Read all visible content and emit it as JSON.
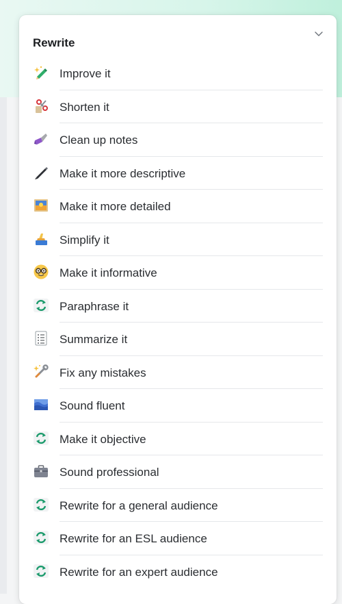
{
  "panel": {
    "title": "Rewrite"
  },
  "items": [
    {
      "label": "Improve it",
      "icon": "pencil-sparkle-icon"
    },
    {
      "label": "Shorten it",
      "icon": "scissors-icon"
    },
    {
      "label": "Clean up notes",
      "icon": "broom-icon"
    },
    {
      "label": "Make it more descriptive",
      "icon": "pen-icon"
    },
    {
      "label": "Make it more detailed",
      "icon": "picture-icon"
    },
    {
      "label": "Simplify it",
      "icon": "sponge-icon"
    },
    {
      "label": "Make it informative",
      "icon": "nerd-face-icon"
    },
    {
      "label": "Paraphrase it",
      "icon": "refresh-icon"
    },
    {
      "label": "Summarize it",
      "icon": "list-icon"
    },
    {
      "label": "Fix any mistakes",
      "icon": "wrench-sparkle-icon"
    },
    {
      "label": "Sound fluent",
      "icon": "waves-icon"
    },
    {
      "label": "Make it objective",
      "icon": "refresh-icon"
    },
    {
      "label": "Sound professional",
      "icon": "briefcase-icon"
    },
    {
      "label": "Rewrite for a general audience",
      "icon": "refresh-icon"
    },
    {
      "label": "Rewrite for an ESL audience",
      "icon": "refresh-icon"
    },
    {
      "label": "Rewrite for an expert audience",
      "icon": "refresh-icon"
    }
  ],
  "colors": {
    "accent": "#1a9a6b",
    "divider": "#e5e7ea",
    "text": "#2a2d31"
  }
}
